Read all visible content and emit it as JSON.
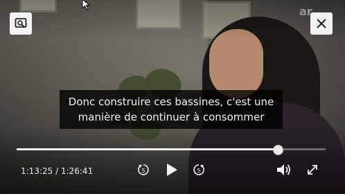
{
  "subtitle": {
    "line1": "Donc construire ces bassines, c'est une",
    "line2": "manière de continuer à consommer"
  },
  "playback": {
    "current_time": "1:13:25",
    "separator": " / ",
    "duration": "1:26:41",
    "progress_fraction": 0.846
  },
  "icons": {
    "top_left": "screen-search-icon",
    "close": "close-icon",
    "rewind": "rewind-5-icon",
    "play": "play-icon",
    "forward": "forward-5-icon",
    "volume": "volume-icon",
    "fullscreen": "fullscreen-icon",
    "cursor": "mouse-cursor-icon"
  },
  "skip": {
    "rewind_label": "5",
    "forward_label": "5"
  },
  "colors": {
    "control": "#f4f4f4",
    "track": "rgba(255,255,255,0.35)"
  }
}
